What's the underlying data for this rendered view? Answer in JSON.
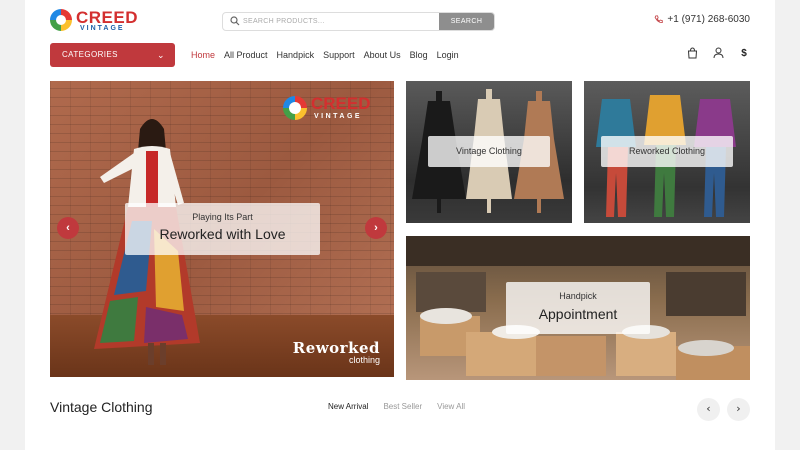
{
  "header": {
    "logo": {
      "brand": "CREED",
      "sub": "VINTAGE"
    },
    "search": {
      "placeholder": "SEARCH PRODUCTS...",
      "button": "SEARCH"
    },
    "phone": "+1 (971) 268-6030"
  },
  "nav": {
    "categories_label": "CATEGORIES",
    "items": [
      "Home",
      "All Product",
      "Handpick",
      "Support",
      "About Us",
      "Blog",
      "Login"
    ],
    "active": "Home",
    "icons": [
      "bag-icon",
      "user-icon",
      "dollar-icon"
    ]
  },
  "hero": {
    "small": "Playing Its Part",
    "big": "Reworked with Love",
    "watermark": {
      "title": "Reworked",
      "sub": "clothing"
    },
    "logo": {
      "brand": "CREED",
      "sub": "VINTAGE"
    }
  },
  "tiles": [
    {
      "label": "Vintage Clothing"
    },
    {
      "label": "Reworked Clothing"
    },
    {
      "small": "Handpick",
      "big": "Appointment"
    }
  ],
  "section": {
    "title": "Vintage Clothing",
    "tabs": [
      "New Arrival",
      "Best Seller",
      "View All"
    ],
    "active_tab": "New Arrival"
  },
  "colors": {
    "accent": "#c0393d",
    "search_button": "#8e8e8e"
  }
}
